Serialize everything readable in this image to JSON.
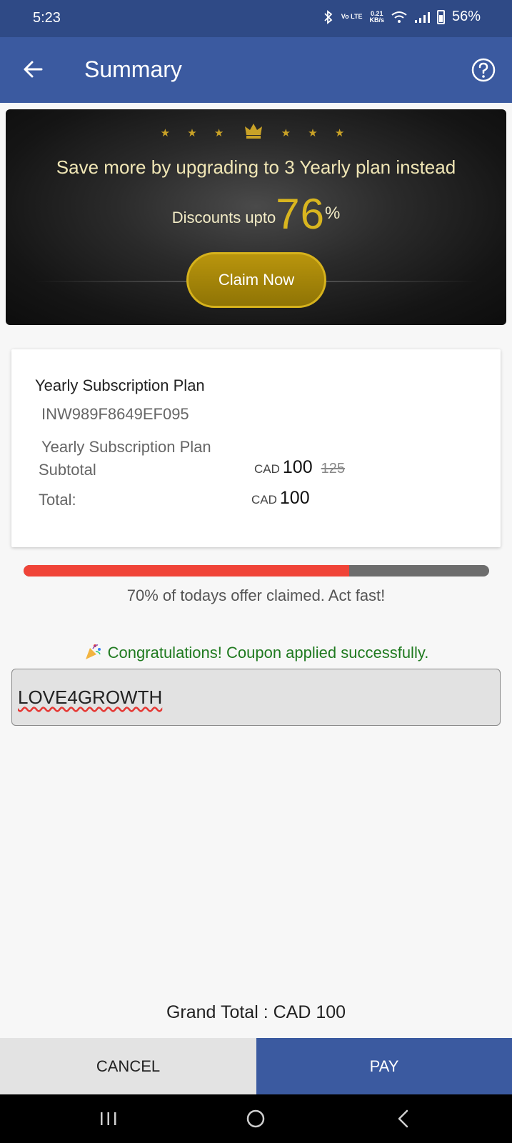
{
  "status_bar": {
    "time": "5:23",
    "network_speed_value": "0.21",
    "network_speed_unit": "KB/s",
    "signal_type": "Vo LTE",
    "battery": "56%"
  },
  "header": {
    "title": "Summary",
    "back_icon": "arrow-left-icon",
    "help_icon": "question-circle-icon"
  },
  "promo": {
    "stars_left": "★ ★ ★",
    "stars_right": "★ ★ ★",
    "headline": "Save more by upgrading to  3 Yearly plan  instead",
    "discount_label": "Discounts upto",
    "discount_value": "76",
    "discount_sign": "%",
    "cta_label": "Claim Now",
    "accent_color": "#d8b51f"
  },
  "summary": {
    "plan_title": "Yearly Subscription Plan",
    "plan_id": "INW989F8649EF095",
    "plan_name": "Yearly Subscription Plan",
    "subtotal_label": "Subtotal",
    "subtotal_currency": "CAD",
    "subtotal_amount": "100",
    "subtotal_original": "125",
    "total_label": "Total:",
    "total_currency": "CAD",
    "total_amount": "100"
  },
  "offer": {
    "progress_fraction": 0.7,
    "fill_color": "#f04438",
    "message": "70% of todays offer claimed. Act fast!"
  },
  "coupon": {
    "success_message": "Congratulations! Coupon applied successfully.",
    "code": "LOVE4GROWTH",
    "icon": "party-popper-icon"
  },
  "footer": {
    "grand_total": "Grand Total : CAD 100",
    "cancel_label": "CANCEL",
    "pay_label": "PAY"
  },
  "nav": {
    "recents_icon": "menu-lines-icon",
    "home_icon": "home-circle-icon",
    "back_icon": "chevron-left-icon"
  }
}
